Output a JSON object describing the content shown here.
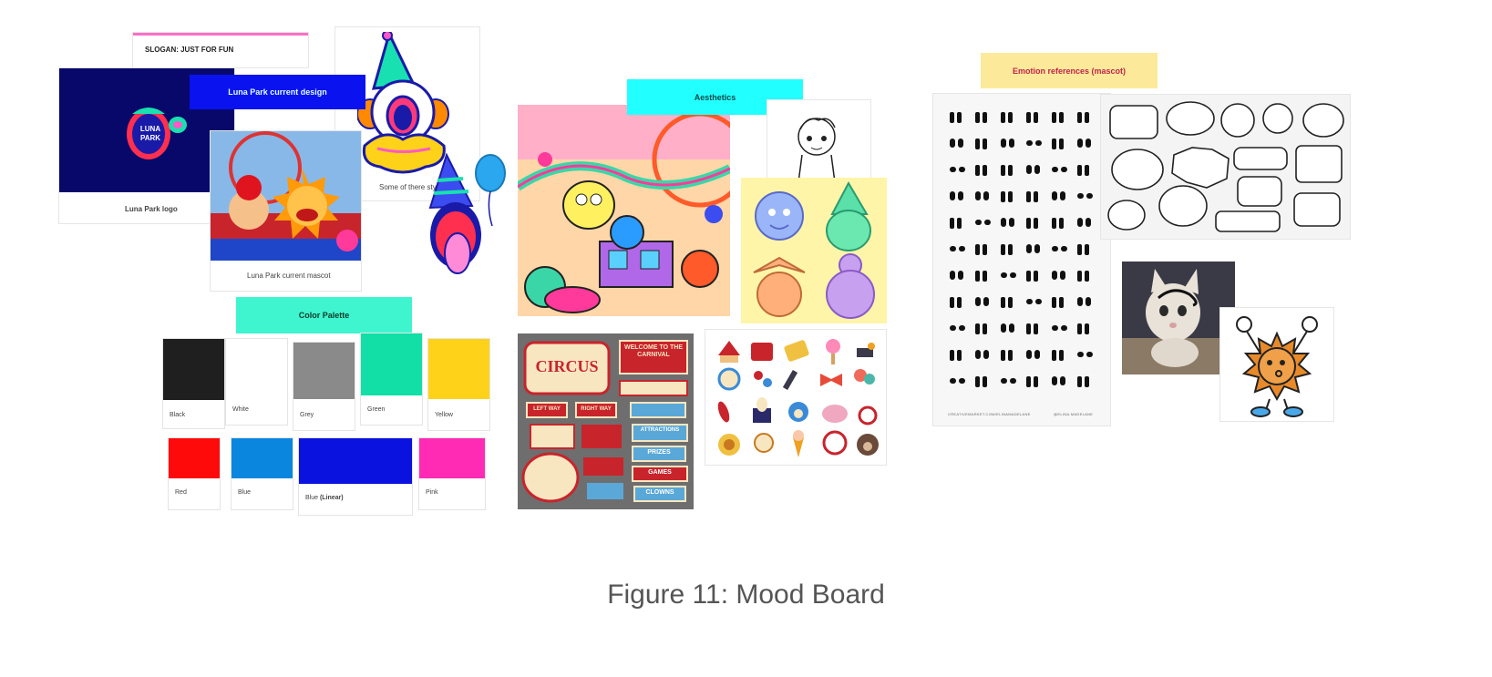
{
  "slogan": "SLOGAN: JUST FOR FUN",
  "sticky_current_design": "Luna Park current design",
  "logo_text": "LUNA\nPARK",
  "logo_caption": "Luna Park logo",
  "mascot_caption": "Luna Park current mascot",
  "style_caption": "Some of there style",
  "sticky_aesthetics": "Aesthetics",
  "sticky_emotions": "Emotion references (mascot)",
  "sticky_palette": "Color Palette",
  "palette": [
    {
      "name": "Black",
      "color": "#1f1f1f"
    },
    {
      "name": "White",
      "color": "#ffffff"
    },
    {
      "name": "Grey",
      "color": "#8a8a8a"
    },
    {
      "name": "Green",
      "color": "#12dfa6"
    },
    {
      "name": "Yellow",
      "color": "#ffd21a"
    },
    {
      "name": "Red",
      "color": "#ff0a0a"
    },
    {
      "name": "Blue",
      "color": "#0b86df"
    },
    {
      "name": "Blue",
      "color": "#0a12e0",
      "suffix": "(Linear)"
    },
    {
      "name": "Pink",
      "color": "#ff2bb5"
    }
  ],
  "circus_signs": [
    "WELCOME TO THE CARNIVAL",
    "CIRCUS",
    "LEFT WAY",
    "RIGHT WAY",
    "ATTRACTIONS",
    "PRIZES",
    "GAMES",
    "CLOWNS"
  ],
  "emotion_credits": [
    "CREATIVEMARKET.COM/ELINAMADELANE",
    "@ELINA.MADELANE"
  ],
  "figure_caption": "Figure 11: Mood Board",
  "colors": {
    "sticky_blue": "#0a12f0",
    "sticky_cyan": "#22ffff",
    "sticky_mint": "#3ff5cf",
    "sticky_yellow": "#fde99a",
    "slogan_bar": "#ff6ec7",
    "logo_bg": "#07086a"
  }
}
